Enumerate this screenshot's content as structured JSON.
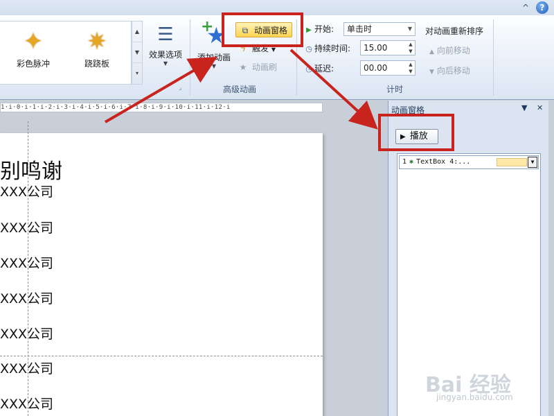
{
  "window": {
    "help_icon": "?",
    "minimize_ribbon_icon": "^"
  },
  "ribbon": {
    "gallery": [
      {
        "label": "彩色脉冲",
        "icon": "star-icon"
      },
      {
        "label": "跷跷板",
        "icon": "star-icon"
      }
    ],
    "effect_options": {
      "label": "效果选项",
      "icon": "list-icon"
    },
    "advanced": {
      "add_animation_label": "添加动画",
      "animation_pane_label": "动画窗格",
      "trigger_label": "触发",
      "painter_label": "动画刷",
      "group_label": "高级动画"
    },
    "timing": {
      "start_label": "开始:",
      "start_value": "单击时",
      "duration_label": "持续时间:",
      "duration_value": "15.00",
      "delay_label": "延迟:",
      "delay_value": "00.00",
      "group_label": "计时"
    },
    "reorder": {
      "title": "对动画重新排序",
      "move_earlier": "向前移动",
      "move_later": "向后移动"
    }
  },
  "ruler": {
    "text": "1·i·0·i·1·i·2·i·3·i·4·i·5·i·6·i·7·i·8·i·9·i·10·i·11·i·12·i"
  },
  "slide": {
    "title": "别鸣谢",
    "lines": [
      "XXX公司",
      "XXX公司",
      "XXX公司",
      "XXX公司",
      "XXX公司",
      "XXX公司",
      "XXX公司"
    ]
  },
  "animation_pane": {
    "title": "动画窗格",
    "play_label": "播放",
    "items": [
      {
        "number": "1",
        "name": "TextBox 4:..."
      }
    ]
  },
  "watermark": {
    "main": "Bai 经验",
    "sub": "jingyan.baidu.com"
  }
}
